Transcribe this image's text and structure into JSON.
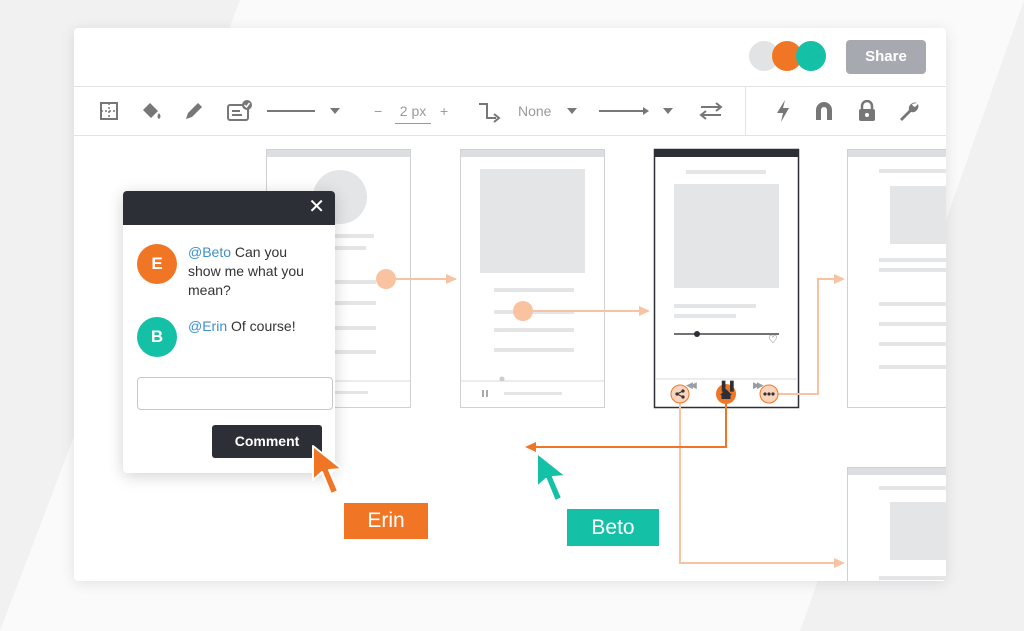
{
  "colors": {
    "accent_orange": "#f07626",
    "accent_teal": "#14c0a6",
    "dark": "#2c2f36",
    "mention_blue": "#3f8fc6",
    "share_gray": "#a6aab0"
  },
  "header": {
    "share_label": "Share",
    "collaborators": [
      {
        "color": "#e2e3e5"
      },
      {
        "color": "#f07626"
      },
      {
        "color": "#14c0a6"
      }
    ]
  },
  "toolbar": {
    "icons": [
      "grid-icon",
      "fill-bucket-icon",
      "pencil-icon",
      "checklist-icon",
      "line-style-icon",
      "stroke-width-icon",
      "connector-icon",
      "arrow-style-icon",
      "swap-icon",
      "lightning-icon",
      "magnet-icon",
      "lock-icon",
      "wrench-icon"
    ],
    "minus_label": "−",
    "stroke_width": "2 px",
    "plus_label": "+",
    "connector_value": "None"
  },
  "comment_popup": {
    "comments": [
      {
        "initial": "E",
        "mention": "@Beto",
        "line1": " Can you",
        "line2": "show me what you",
        "line3": "mean?"
      },
      {
        "initial": "B",
        "mention": "@Erin",
        "text": " Of course!"
      }
    ],
    "input_placeholder": "",
    "button_label": "Comment",
    "close_label": "✕"
  },
  "cursors": [
    {
      "name": "Erin",
      "color": "#f07626"
    },
    {
      "name": "Beto",
      "color": "#14c0a6"
    }
  ],
  "phone_controls": {
    "rewind": "◀◀",
    "pause": "❚❚",
    "forward": "▶▶",
    "heart": "♡"
  }
}
